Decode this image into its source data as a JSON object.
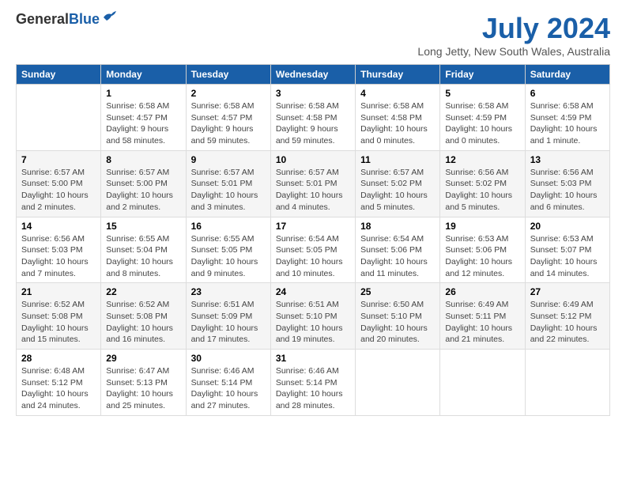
{
  "header": {
    "logo_general": "General",
    "logo_blue": "Blue",
    "title": "July 2024",
    "location": "Long Jetty, New South Wales, Australia"
  },
  "days_of_week": [
    "Sunday",
    "Monday",
    "Tuesday",
    "Wednesday",
    "Thursday",
    "Friday",
    "Saturday"
  ],
  "weeks": [
    [
      {
        "day": "",
        "info": ""
      },
      {
        "day": "1",
        "info": "Sunrise: 6:58 AM\nSunset: 4:57 PM\nDaylight: 9 hours\nand 58 minutes."
      },
      {
        "day": "2",
        "info": "Sunrise: 6:58 AM\nSunset: 4:57 PM\nDaylight: 9 hours\nand 59 minutes."
      },
      {
        "day": "3",
        "info": "Sunrise: 6:58 AM\nSunset: 4:58 PM\nDaylight: 9 hours\nand 59 minutes."
      },
      {
        "day": "4",
        "info": "Sunrise: 6:58 AM\nSunset: 4:58 PM\nDaylight: 10 hours\nand 0 minutes."
      },
      {
        "day": "5",
        "info": "Sunrise: 6:58 AM\nSunset: 4:59 PM\nDaylight: 10 hours\nand 0 minutes."
      },
      {
        "day": "6",
        "info": "Sunrise: 6:58 AM\nSunset: 4:59 PM\nDaylight: 10 hours\nand 1 minute."
      }
    ],
    [
      {
        "day": "7",
        "info": "Sunrise: 6:57 AM\nSunset: 5:00 PM\nDaylight: 10 hours\nand 2 minutes."
      },
      {
        "day": "8",
        "info": "Sunrise: 6:57 AM\nSunset: 5:00 PM\nDaylight: 10 hours\nand 2 minutes."
      },
      {
        "day": "9",
        "info": "Sunrise: 6:57 AM\nSunset: 5:01 PM\nDaylight: 10 hours\nand 3 minutes."
      },
      {
        "day": "10",
        "info": "Sunrise: 6:57 AM\nSunset: 5:01 PM\nDaylight: 10 hours\nand 4 minutes."
      },
      {
        "day": "11",
        "info": "Sunrise: 6:57 AM\nSunset: 5:02 PM\nDaylight: 10 hours\nand 5 minutes."
      },
      {
        "day": "12",
        "info": "Sunrise: 6:56 AM\nSunset: 5:02 PM\nDaylight: 10 hours\nand 5 minutes."
      },
      {
        "day": "13",
        "info": "Sunrise: 6:56 AM\nSunset: 5:03 PM\nDaylight: 10 hours\nand 6 minutes."
      }
    ],
    [
      {
        "day": "14",
        "info": "Sunrise: 6:56 AM\nSunset: 5:03 PM\nDaylight: 10 hours\nand 7 minutes."
      },
      {
        "day": "15",
        "info": "Sunrise: 6:55 AM\nSunset: 5:04 PM\nDaylight: 10 hours\nand 8 minutes."
      },
      {
        "day": "16",
        "info": "Sunrise: 6:55 AM\nSunset: 5:05 PM\nDaylight: 10 hours\nand 9 minutes."
      },
      {
        "day": "17",
        "info": "Sunrise: 6:54 AM\nSunset: 5:05 PM\nDaylight: 10 hours\nand 10 minutes."
      },
      {
        "day": "18",
        "info": "Sunrise: 6:54 AM\nSunset: 5:06 PM\nDaylight: 10 hours\nand 11 minutes."
      },
      {
        "day": "19",
        "info": "Sunrise: 6:53 AM\nSunset: 5:06 PM\nDaylight: 10 hours\nand 12 minutes."
      },
      {
        "day": "20",
        "info": "Sunrise: 6:53 AM\nSunset: 5:07 PM\nDaylight: 10 hours\nand 14 minutes."
      }
    ],
    [
      {
        "day": "21",
        "info": "Sunrise: 6:52 AM\nSunset: 5:08 PM\nDaylight: 10 hours\nand 15 minutes."
      },
      {
        "day": "22",
        "info": "Sunrise: 6:52 AM\nSunset: 5:08 PM\nDaylight: 10 hours\nand 16 minutes."
      },
      {
        "day": "23",
        "info": "Sunrise: 6:51 AM\nSunset: 5:09 PM\nDaylight: 10 hours\nand 17 minutes."
      },
      {
        "day": "24",
        "info": "Sunrise: 6:51 AM\nSunset: 5:10 PM\nDaylight: 10 hours\nand 19 minutes."
      },
      {
        "day": "25",
        "info": "Sunrise: 6:50 AM\nSunset: 5:10 PM\nDaylight: 10 hours\nand 20 minutes."
      },
      {
        "day": "26",
        "info": "Sunrise: 6:49 AM\nSunset: 5:11 PM\nDaylight: 10 hours\nand 21 minutes."
      },
      {
        "day": "27",
        "info": "Sunrise: 6:49 AM\nSunset: 5:12 PM\nDaylight: 10 hours\nand 22 minutes."
      }
    ],
    [
      {
        "day": "28",
        "info": "Sunrise: 6:48 AM\nSunset: 5:12 PM\nDaylight: 10 hours\nand 24 minutes."
      },
      {
        "day": "29",
        "info": "Sunrise: 6:47 AM\nSunset: 5:13 PM\nDaylight: 10 hours\nand 25 minutes."
      },
      {
        "day": "30",
        "info": "Sunrise: 6:46 AM\nSunset: 5:14 PM\nDaylight: 10 hours\nand 27 minutes."
      },
      {
        "day": "31",
        "info": "Sunrise: 6:46 AM\nSunset: 5:14 PM\nDaylight: 10 hours\nand 28 minutes."
      },
      {
        "day": "",
        "info": ""
      },
      {
        "day": "",
        "info": ""
      },
      {
        "day": "",
        "info": ""
      }
    ]
  ]
}
